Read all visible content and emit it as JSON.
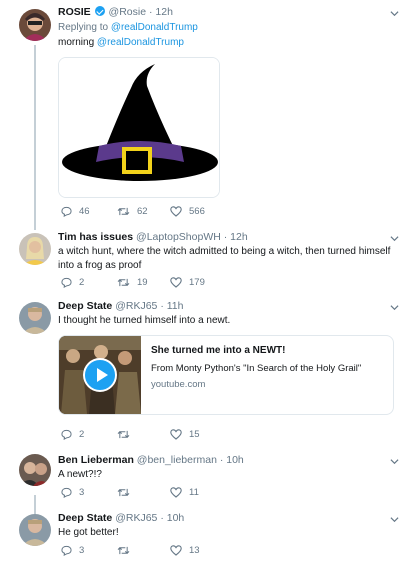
{
  "tweets": [
    {
      "name": "ROSIE",
      "verified": true,
      "handle": "@Rosie",
      "time": "12h",
      "replying_prefix": "Replying to",
      "replying_to": "@realDonaldTrump",
      "text_plain": "morning",
      "text_mention": "@realDonaldTrump",
      "replies": "46",
      "retweets": "62",
      "likes": "566"
    },
    {
      "name": "Tim has issues",
      "handle": "@LaptopShopWH",
      "time": "12h",
      "text": "a witch hunt, where the witch admitted to being a witch, then turned himself into a frog as proof",
      "replies": "2",
      "retweets": "19",
      "likes": "179"
    },
    {
      "name": "Deep State",
      "handle": "@RKJ65",
      "time": "11h",
      "text": "I thought he turned himself into a newt.",
      "card": {
        "title": "She turned me into a NEWT!",
        "description": "From Monty Python's \"In Search of the Holy Grail\"",
        "domain": "youtube.com"
      },
      "replies": "2",
      "retweets": "",
      "likes": "15"
    },
    {
      "name": "Ben Lieberman",
      "handle": "@ben_lieberman",
      "time": "10h",
      "text": "A newt?!?",
      "replies": "3",
      "retweets": "",
      "likes": "11"
    },
    {
      "name": "Deep State",
      "handle": "@RKJ65",
      "time": "10h",
      "text": "He got better!",
      "replies": "3",
      "retweets": "",
      "likes": "13"
    }
  ],
  "colors": {
    "accent": "#1da1f2",
    "link": "#1b95e0",
    "muted": "#657786",
    "hat": "#000000",
    "hat_band": "#6a3d9a",
    "buckle": "#f2d21b"
  },
  "icons": [
    "reply-icon",
    "retweet-icon",
    "like-icon",
    "chevron-down-icon",
    "verified-icon",
    "play-icon"
  ]
}
